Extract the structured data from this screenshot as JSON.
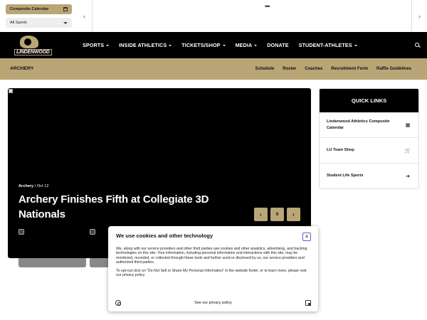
{
  "topbar": {
    "calendar_label": "Composite Calendar",
    "sports_label": "All Sports",
    "prev_glyph": "‹",
    "next_glyph": "›",
    "dots": "•••"
  },
  "nav": {
    "logo_text": "LINDENWOOD",
    "items": [
      {
        "label": "SPORTS"
      },
      {
        "label": "INSIDE ATHLETICS"
      },
      {
        "label": "TICKETS/SHOP"
      },
      {
        "label": "MEDIA"
      },
      {
        "label": "DONATE"
      },
      {
        "label": "STUDENT-ATHLETES"
      }
    ]
  },
  "subnav": {
    "sport": "ARCHERY",
    "links": [
      "Schedule",
      "Roster",
      "Coaches",
      "Recruitment Form",
      "Raffle Guidelines"
    ]
  },
  "hero": {
    "category": "Archery",
    "separator": " / ",
    "date": "Oct 12",
    "headline": "Archery Finishes Fifth at Collegiate 3D Nationals",
    "controls": {
      "prev": "‹",
      "pause": "II",
      "next": "›"
    }
  },
  "quick_links": {
    "title": "QUICK LINKS",
    "items": [
      {
        "label": "Lindenwood Athletics Composite Calendar",
        "icon": "calendar-icon",
        "glyph": "▦"
      },
      {
        "label": "LU Team Shop",
        "icon": "cart-icon",
        "glyph": "🛒"
      },
      {
        "label": "Student Life Sports",
        "icon": "arrow-right-icon",
        "glyph": "➔"
      }
    ]
  },
  "cookie": {
    "title": "We use cookies and other technology",
    "close": "✕",
    "paragraph1": "We, along with our service providers and other third parties use cookies and other analytics, advertising, and tracking technologies on this site. Your information, including personal information and interactions with this site, may be monitored, recorded, or collected through these tools and further used or disclosed by us, our service providers and authorized third parties.",
    "paragraph2": "To opt-out click on “Do Not Sell or Share My Personal Information” in the website footer, or to learn more, please visit our privacy policy.",
    "privacy_link": "See our privacy policy"
  },
  "colors": {
    "gold": "#b9a576",
    "black": "#000000"
  }
}
